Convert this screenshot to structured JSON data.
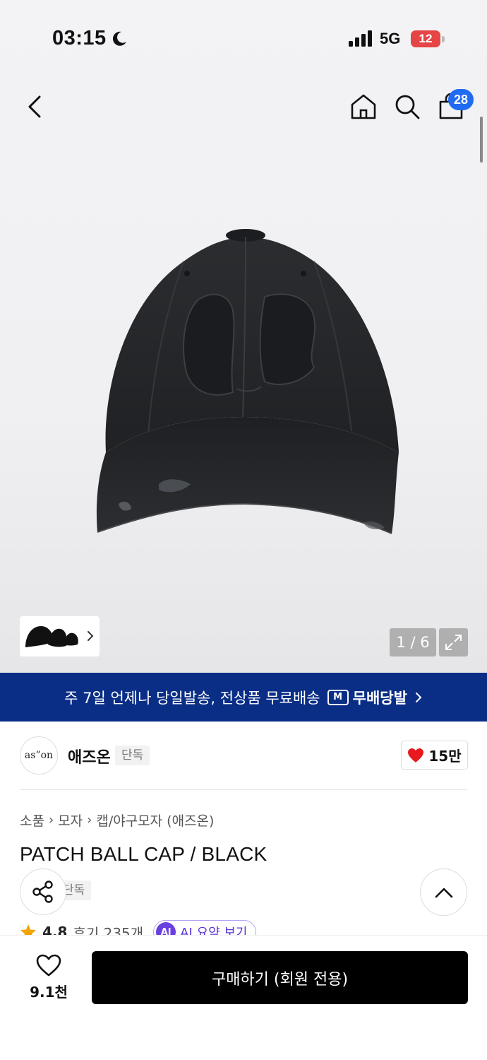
{
  "status_bar": {
    "time": "03:15",
    "network": "5G",
    "battery": "12"
  },
  "nav": {
    "cart_count": "28"
  },
  "gallery": {
    "counter": "1 / 6"
  },
  "promo": {
    "text": "주 7일 언제나 당일발송, 전상품 무료배송",
    "logo_mark": "M",
    "logo_text": "무배당발"
  },
  "brand": {
    "logo_text": "as”on",
    "name": "애즈온",
    "tag": "단독",
    "likes": "15만"
  },
  "breadcrumb": [
    "소품",
    "모자",
    "캡/야구모자 (애즈온)"
  ],
  "product": {
    "title": "PATCH BALL CAP / BLACK",
    "tag": "단독",
    "rating": "4.8",
    "reviews": "후기 235개",
    "ai_badge": "AI",
    "ai_label": "AI 요약 보기"
  },
  "bottom": {
    "wish_count": "9.1천",
    "buy_label": "구매하기 (회원 전용)"
  },
  "colors": {
    "promo_bg": "#0a2e86",
    "badge_blue": "#1f6bf2",
    "heart_red": "#e8191f",
    "ai_purple": "#6a3fe0"
  }
}
